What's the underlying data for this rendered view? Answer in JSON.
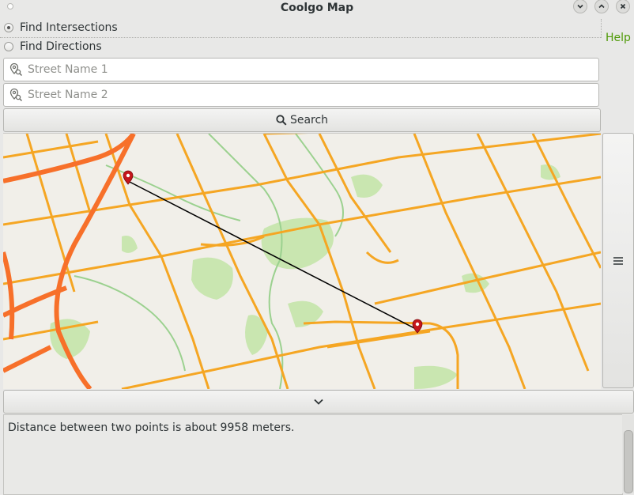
{
  "window": {
    "title": "Coolgo Map"
  },
  "mode": {
    "options": [
      {
        "label": "Find Intersections",
        "selected": true
      },
      {
        "label": "Find Directions",
        "selected": false
      }
    ]
  },
  "help_label": "Help",
  "search": {
    "street1_placeholder": "Street Name 1",
    "street1_value": "",
    "street2_placeholder": "Street Name 2",
    "street2_value": "",
    "button_label": "Search"
  },
  "map": {
    "marker_icon": "map-pin-icon",
    "route_line": "straight-line-between-markers",
    "menu_icon": "hamburger-menu-icon"
  },
  "expand_icon": "chevron-down-icon",
  "output": {
    "text": "Distance between two points is about 9958 meters."
  },
  "colors": {
    "accent": "#4e9a06",
    "marker": "#c4161c",
    "highway": "#f7702a",
    "arterial": "#f5a623",
    "park": "#c9e6b0",
    "map_bg": "#f1efe9"
  }
}
